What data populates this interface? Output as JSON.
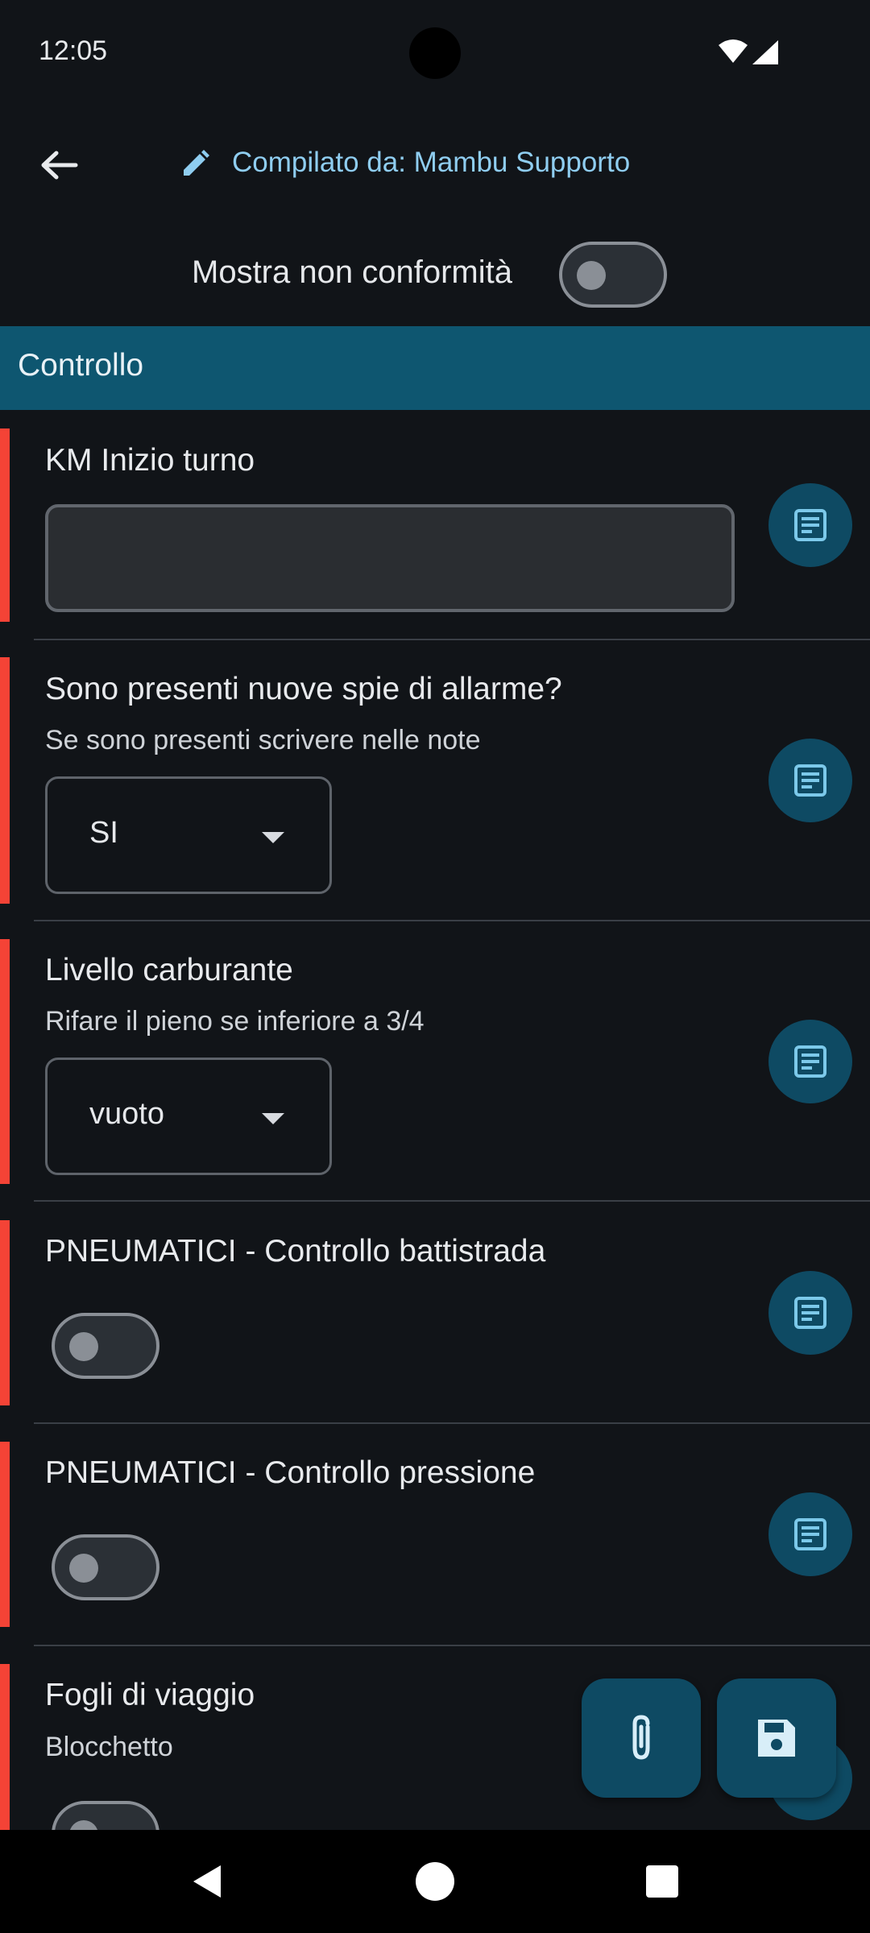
{
  "status_bar": {
    "time": "12:05"
  },
  "app_bar": {
    "compiled_by": "Compilato da: Mambu Supporto"
  },
  "filter": {
    "label": "Mostra non conformità",
    "enabled": false
  },
  "section": {
    "title": "Controllo"
  },
  "items": [
    {
      "title": "KM Inizio turno",
      "subtitle": "",
      "type": "text",
      "value": ""
    },
    {
      "title": "Sono presenti nuove spie di allarme?",
      "subtitle": "Se sono presenti scrivere nelle note",
      "type": "dropdown",
      "value": "SI"
    },
    {
      "title": "Livello carburante",
      "subtitle": "Rifare il pieno se inferiore a 3/4",
      "type": "dropdown",
      "value": "vuoto"
    },
    {
      "title": "PNEUMATICI - Controllo battistrada",
      "subtitle": "",
      "type": "switch",
      "value": false
    },
    {
      "title": "PNEUMATICI - Controllo pressione",
      "subtitle": "",
      "type": "switch",
      "value": false
    },
    {
      "title": "Fogli di viaggio",
      "subtitle": "Blocchetto",
      "type": "switch",
      "value": false
    }
  ],
  "colors": {
    "section_bg": "#0e5670",
    "accent": "#8fcdf0",
    "required_bar": "#f44336",
    "fab_bg": "#0e4a63"
  },
  "icons": {
    "back": "arrow-left-icon",
    "edit": "pencil-icon",
    "note": "note-icon",
    "attach": "paperclip-icon",
    "save": "floppy-disk-icon"
  }
}
